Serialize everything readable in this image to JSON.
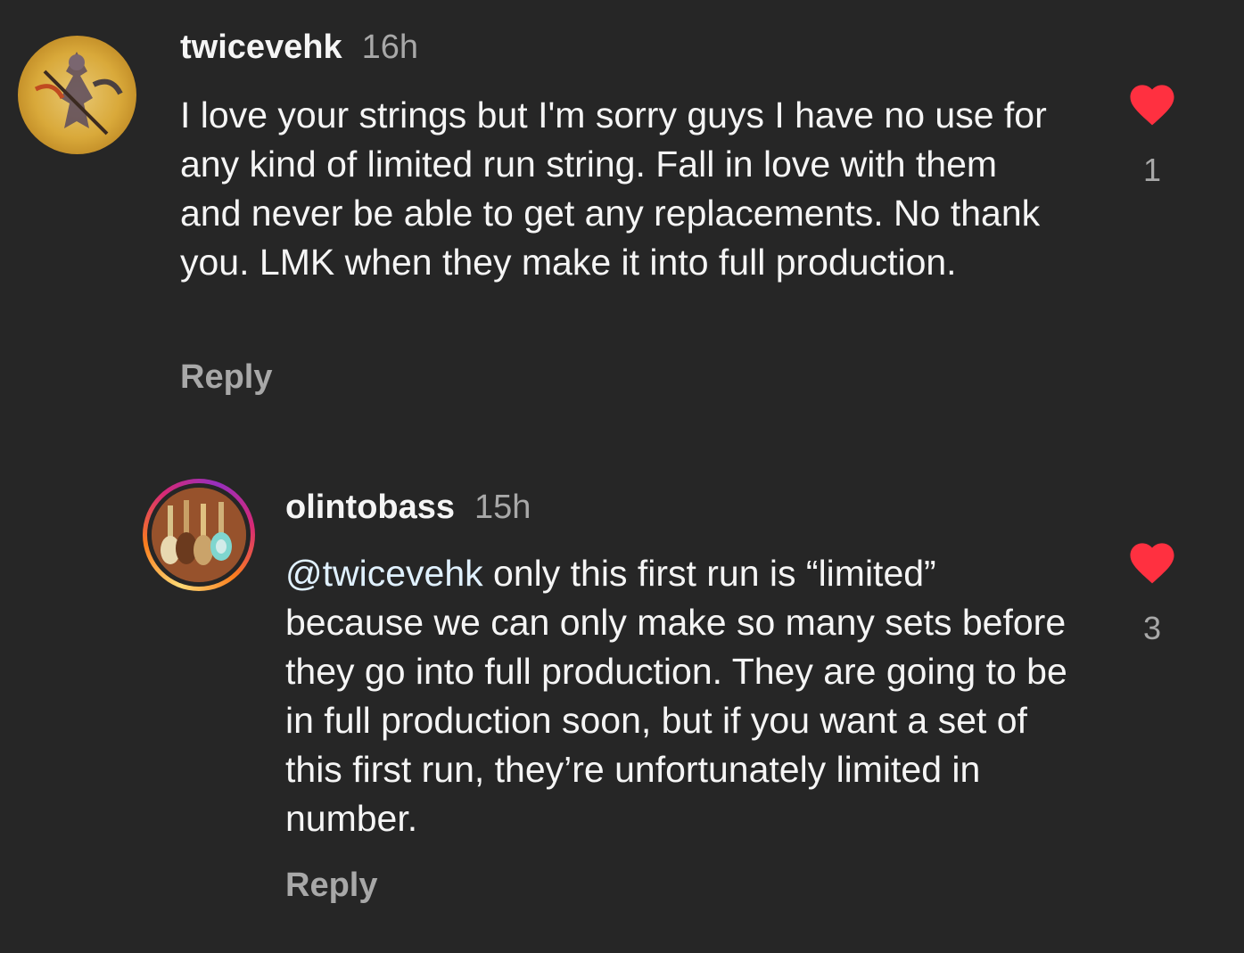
{
  "comments": [
    {
      "username": "twicevehk",
      "time": "16h",
      "text": "I love your strings but I'm sorry guys I have no use for any kind of limited run string. Fall in love with them and never be able to get any replacements. No thank you. LMK when they make it into full production.",
      "reply_label": "Reply",
      "like_count": "1",
      "avatar_icon": "warrior-artwork-avatar"
    },
    {
      "username": "olintobass",
      "time": "15h",
      "mention": "@twicevehk",
      "text": " only this first run is “limited” because we can only make so many sets before they go into full production. They are going to be in full production soon, but if you want a set of this first run, they’re unfortunately limited in number.",
      "reply_label": "Reply",
      "like_count": "3",
      "avatar_icon": "bass-guitars-avatar"
    }
  ],
  "colors": {
    "background": "#262626",
    "like_red": "#ff3040",
    "story_ring": [
      "#feda75",
      "#fa7e1e",
      "#d62976",
      "#962fbf"
    ]
  }
}
